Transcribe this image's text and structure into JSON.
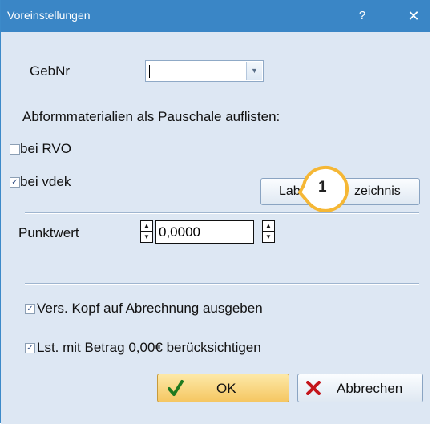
{
  "window": {
    "title": "Voreinstellungen",
    "help_label": "?",
    "close_label": "✕"
  },
  "gebnr": {
    "label": "GebNr",
    "value": ""
  },
  "pauschale": {
    "heading": "Abformmaterialien als Pauschale auflisten:",
    "bei_rvo": {
      "label": "bei RVO",
      "checked": false
    },
    "bei_vdek": {
      "label": "bei vdek",
      "checked": true
    }
  },
  "labor_button": {
    "label_visible_left": "Lab",
    "label_visible_right": "zeichnis"
  },
  "punktwert": {
    "label": "Punktwert",
    "value": "0,0000"
  },
  "options": {
    "vers_kopf": {
      "label": "Vers. Kopf auf Abrechnung ausgeben",
      "checked": true
    },
    "lst_betrag": {
      "label": "Lst. mit Betrag 0,00€ berücksichtigen",
      "checked": true
    }
  },
  "callout": {
    "number": "1",
    "color": "#f5b735"
  },
  "footer": {
    "ok_label": "OK",
    "cancel_label": "Abbrechen",
    "ok_icon": "checkmark-icon",
    "cancel_icon": "x-icon"
  }
}
